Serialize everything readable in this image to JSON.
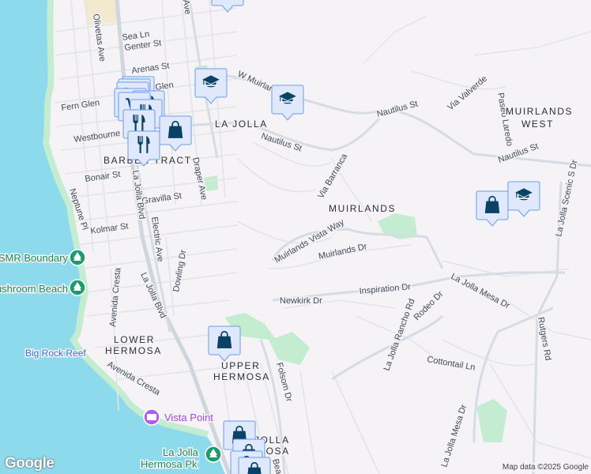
{
  "colors": {
    "water": "#8ddaec",
    "land": "#f5f3f5",
    "park": "#c3ecd0",
    "marker_bg": "#dfe9fb",
    "marker_border": "#6d9ce6",
    "marker_icon": "#0a4266"
  },
  "streets": {
    "sea_ln": "Sea Ln",
    "genter_st": "Genter St",
    "arenas_st": "Arenas St",
    "glen": "Glen",
    "fern_glen": "Fern Glen",
    "westbourne_st": "Westbourne St",
    "bonair_st": "Bonair St",
    "gravilla_st": "Gravilla St",
    "kolmar_st": "Kolmar St",
    "olivetas_ave": "Olivetas Ave",
    "draper_ave_top": "Ave",
    "draper_ave": "Draper Ave",
    "neptune_pl": "Neptune Pl",
    "la_jolla_blvd_1": "La Jolla Blvd",
    "la_jolla_blvd_2": "La Jolla Blvd",
    "electric_ave": "Electric Ave",
    "dowling_dr": "Dowling Dr",
    "avenida_cresta_1": "Avenida Cresta",
    "avenida_cresta_2": "Avenida Cresta",
    "w_muirlands": "W Muirlands",
    "nautilus_st_1": "Nautilus St",
    "nautilus_st_2": "Nautilus St",
    "nautilus_st_3": "Nautilus St",
    "via_valverde": "Via Valverde",
    "paseo_laredo": "Paseo Laredo",
    "via_barranca": "Via Barranca",
    "muirlands_vista_way": "Muirlands Vista Way",
    "muirlands_dr": "Muirlands Dr",
    "newkirk_dr": "Newkirk Dr",
    "inspiration_dr": "Inspiration Dr",
    "la_jolla_mesa_dr_1": "La Jolla Mesa Dr",
    "la_jolla_mesa_dr_2": "La Jolla Mesa Dr",
    "rodeo_dr": "Rodeo Dr",
    "la_jolla_rancho_rd": "La Jolla Rancho Rd",
    "cottontail_ln": "Cottontail Ln",
    "rutgers_rd": "Rutgers Rd",
    "la_jolla_scenic_s_dr": "La Jolla Scenic S Dr",
    "folsom_dr": "Folsom Dr",
    "bea": "Bea"
  },
  "neighborhoods": {
    "la_jolla": "LA JOLLA",
    "barber_tract": "BARBER TRACT",
    "muirlands": "MUIRLANDS",
    "muirlands_west_1": "MUIRLANDS",
    "muirlands_west_2": "WEST",
    "lower_hermosa_1": "LOWER",
    "lower_hermosa_2": "HERMOSA",
    "upper_hermosa_1": "UPPER",
    "upper_hermosa_2": "HERMOSA",
    "la_jolla_hermosa_1": "JOLLA",
    "la_jolla_hermosa_2": "MOSA"
  },
  "pois": {
    "smr_boundary": "SMR Boundary",
    "mushroom_beach": "Mushroom Beach",
    "big_rock_reef": "Big Rock Reef",
    "vista_point": "Vista Point",
    "hermosa_pk_1": "La Jolla",
    "hermosa_pk_2": "Hermosa Pk"
  },
  "footer": {
    "logo": "Google",
    "attribution": "Map data ©2025 Google"
  }
}
